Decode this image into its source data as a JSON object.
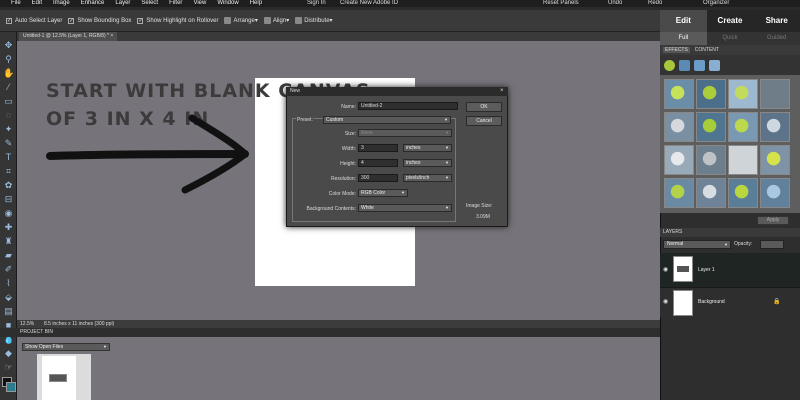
{
  "menu": [
    "File",
    "Edit",
    "Image",
    "Enhance",
    "Layer",
    "Select",
    "Filter",
    "View",
    "Window",
    "Help"
  ],
  "menu_right": {
    "signin": "Sign In",
    "create_id": "Create New Adobe ID",
    "reset": "Reset Panels",
    "undo": "Undo",
    "redo": "Redo",
    "organizer": "Organizer"
  },
  "options": {
    "auto_select": "Auto Select Layer",
    "bounding_box": "Show Bounding Box",
    "highlight": "Show Highlight on Rollover",
    "arrange": "Arrange",
    "align": "Align",
    "distribute": "Distribute"
  },
  "doc_tab": "Untitled-1 @ 12.5% (Layer 1, RGB/8) *",
  "status": {
    "zoom": "12.5%",
    "size": "8.5 inches x 11 inches (300 ppi)"
  },
  "annotation": {
    "line1": "START WITH BLANK CANVAS",
    "line2": "OF 3 IN X 4 IN"
  },
  "dialog": {
    "title": "New",
    "name_label": "Name:",
    "name_value": "Untitled-2",
    "preset_label": "Preset:",
    "preset_value": "Custom",
    "size_label": "Size:",
    "size_value": "None",
    "width_label": "Width:",
    "width_value": "3",
    "width_unit": "inches",
    "height_label": "Height:",
    "height_value": "4",
    "height_unit": "inches",
    "resolution_label": "Resolution:",
    "resolution_value": "300",
    "resolution_unit": "pixels/inch",
    "color_mode_label": "Color Mode:",
    "color_mode_value": "RGB Color",
    "bg_label": "Background Contents:",
    "bg_value": "White",
    "ok": "OK",
    "cancel": "Cancel",
    "image_size_label": "Image Size:",
    "image_size_value": "3.09M"
  },
  "mode_tabs": [
    "Edit",
    "Create",
    "Share"
  ],
  "sub_tabs": [
    "Full",
    "Quick",
    "Guided"
  ],
  "panel_tabs": {
    "effects": "EFFECTS",
    "content": "CONTENT"
  },
  "apply": "Apply",
  "layers": {
    "header": "LAYERS",
    "blend": "Normal",
    "opacity_label": "Opacity:",
    "items": [
      {
        "name": "Layer 1"
      },
      {
        "name": "Background"
      }
    ]
  },
  "project_bin": {
    "header": "PROJECT BIN",
    "select": "Show Open Files"
  },
  "colors": {
    "workspace": "#77737a",
    "panel": "#2e2e2e",
    "accent": "#a7c63c"
  }
}
